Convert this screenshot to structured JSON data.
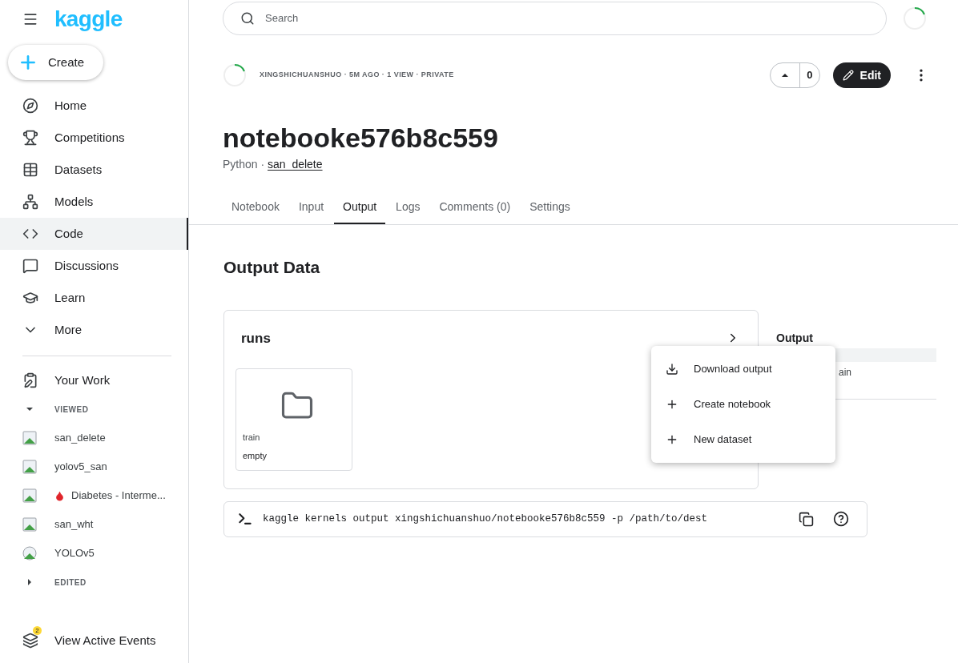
{
  "sidebar": {
    "logo": "kaggle",
    "create_label": "Create",
    "nav": [
      {
        "label": "Home",
        "selected": false
      },
      {
        "label": "Competitions",
        "selected": false
      },
      {
        "label": "Datasets",
        "selected": false
      },
      {
        "label": "Models",
        "selected": false
      },
      {
        "label": "Code",
        "selected": true
      },
      {
        "label": "Discussions",
        "selected": false
      },
      {
        "label": "Learn",
        "selected": false
      },
      {
        "label": "More",
        "selected": false
      }
    ],
    "your_work": "Your Work",
    "sections": [
      {
        "title": "VIEWED",
        "expanded": true,
        "items": [
          {
            "label": "san_delete"
          },
          {
            "label": "yolov5_san"
          },
          {
            "label": "Diabetes - Interme...",
            "drop": true
          },
          {
            "label": "san_wht"
          },
          {
            "label": "YOLOv5",
            "round": true
          }
        ]
      },
      {
        "title": "EDITED",
        "expanded": false
      }
    ],
    "events": {
      "label": "View Active Events",
      "badge": "2"
    }
  },
  "search": {
    "placeholder": "Search"
  },
  "header": {
    "meta": "XINGSHICHUANSHUO · 5M AGO · 1 VIEW · PRIVATE",
    "votes": "0",
    "edit_label": "Edit"
  },
  "title": "notebooke576b8c559",
  "subtitle": {
    "language": "Python · ",
    "link": "san_delete"
  },
  "tabs": [
    {
      "label": "Notebook",
      "selected": false
    },
    {
      "label": "Input",
      "selected": false
    },
    {
      "label": "Output",
      "selected": true
    },
    {
      "label": "Logs",
      "selected": false
    },
    {
      "label": "Comments (0)",
      "selected": false
    },
    {
      "label": "Settings",
      "selected": false
    }
  ],
  "section_title": "Output Data",
  "folder_card": {
    "title": "runs",
    "file": {
      "name": "train",
      "status": "empty"
    }
  },
  "side_panel": {
    "title": "Output",
    "item": "ain"
  },
  "menu": [
    {
      "label": "Download output"
    },
    {
      "label": "Create notebook"
    },
    {
      "label": "New dataset"
    }
  ],
  "command": "kaggle kernels output xingshichuanshuo/notebooke576b8c559 -p /path/to/dest"
}
